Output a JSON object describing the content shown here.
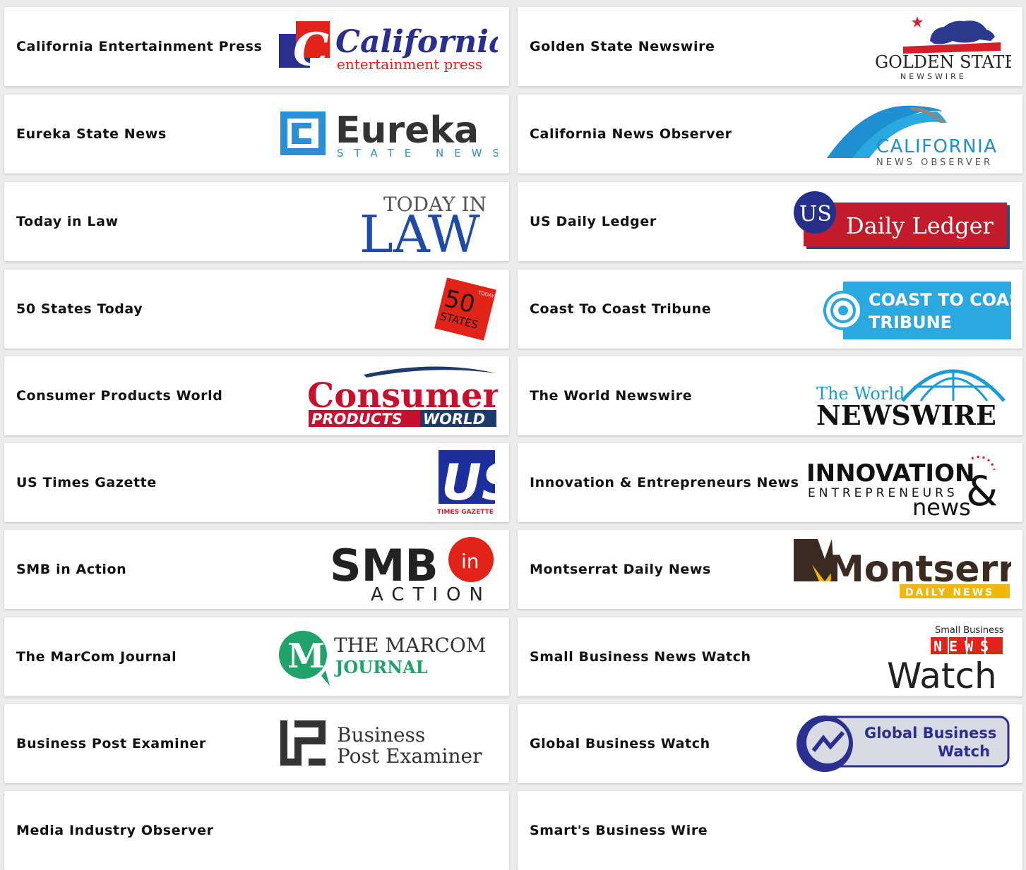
{
  "publications": [
    {
      "name": "California Entertainment Press",
      "logo_icon": "california-entertainment-press-logo",
      "logo_text": [
        "California",
        "entertainment press"
      ],
      "colors": {
        "blue": "#2a2f8f",
        "red": "#e2231a"
      }
    },
    {
      "name": "Golden State Newswire",
      "logo_icon": "golden-state-newswire-logo",
      "logo_text": [
        "GOLDEN STATE",
        "NEWSWIRE"
      ],
      "colors": {
        "blue": "#2b3a8c",
        "red": "#d5202b"
      }
    },
    {
      "name": "Eureka State News",
      "logo_icon": "eureka-state-news-logo",
      "logo_text": [
        "Eureka",
        "STATE NEWS"
      ],
      "colors": {
        "blue": "#2b8fd6",
        "dark": "#333333"
      }
    },
    {
      "name": "California News Observer",
      "logo_icon": "california-news-observer-logo",
      "logo_text": [
        "CALIFORNIA",
        "NEWS OBSERVER"
      ],
      "colors": {
        "blue": "#1e8fd0",
        "gray": "#555555"
      }
    },
    {
      "name": "Today in Law",
      "logo_icon": "today-in-law-logo",
      "logo_text": [
        "TODAY IN",
        "LAW"
      ],
      "colors": {
        "blue": "#1f4aa8",
        "gray": "#555555"
      }
    },
    {
      "name": "US Daily Ledger",
      "logo_icon": "us-daily-ledger-logo",
      "logo_text": [
        "US",
        "Daily Ledger"
      ],
      "colors": {
        "blue": "#262f8a",
        "red": "#c21c2c"
      }
    },
    {
      "name": "50 States Today",
      "logo_icon": "50-states-today-logo",
      "logo_text": [
        "50",
        "STATES",
        "TODAY"
      ],
      "colors": {
        "red": "#e2231a"
      }
    },
    {
      "name": "Coast To Coast Tribune",
      "logo_icon": "coast-to-coast-tribune-logo",
      "logo_text": [
        "COAST TO COAST",
        "TRIBUNE"
      ],
      "colors": {
        "blue": "#2aa8e0"
      }
    },
    {
      "name": "Consumer Products World",
      "logo_icon": "consumer-products-world-logo",
      "logo_text": [
        "Consumer",
        "PRODUCTS",
        "WORLD"
      ],
      "colors": {
        "red": "#c8102e",
        "navy": "#1d3a6e"
      }
    },
    {
      "name": "The World Newswire",
      "logo_icon": "the-world-newswire-logo",
      "logo_text": [
        "The World",
        "NEWSWIRE"
      ],
      "colors": {
        "blue": "#1a9ad6",
        "dark": "#111111"
      }
    },
    {
      "name": "US Times Gazette",
      "logo_icon": "us-times-gazette-logo",
      "logo_text": [
        "US",
        "TIMES GAZETTE"
      ],
      "colors": {
        "blue": "#1c2f9c",
        "red": "#d52027"
      }
    },
    {
      "name": "Innovation & Entrepreneurs News",
      "logo_icon": "innovation-entrepreneurs-news-logo",
      "logo_text": [
        "INNOVATION",
        "ENTREPRENEURS",
        "news",
        "&"
      ],
      "colors": {
        "dark": "#111111",
        "red": "#d52027"
      }
    },
    {
      "name": "SMB in Action",
      "logo_icon": "smb-in-action-logo",
      "logo_text": [
        "SMB",
        "in",
        "ACTION"
      ],
      "colors": {
        "dark": "#222222",
        "red": "#e2231a"
      }
    },
    {
      "name": "Montserrat Daily News",
      "logo_icon": "montserrat-daily-news-logo",
      "logo_text": [
        "Montserrat",
        "DAILY NEWS"
      ],
      "colors": {
        "brown": "#3a2a22",
        "yellow": "#f2b705"
      }
    },
    {
      "name": "The MarCom Journal",
      "logo_icon": "marcom-journal-logo",
      "logo_text": [
        "THE MARCOM",
        "JOURNAL"
      ],
      "colors": {
        "green": "#1fa36a",
        "dark": "#333333"
      }
    },
    {
      "name": "Small Business News Watch",
      "logo_icon": "small-business-news-watch-logo",
      "logo_text": [
        "Small Business",
        "NEWS",
        "Watch"
      ],
      "colors": {
        "red": "#e2231a",
        "dark": "#222222"
      }
    },
    {
      "name": "Business Post Examiner",
      "logo_icon": "business-post-examiner-logo",
      "logo_text": [
        "Business",
        "Post Examiner"
      ],
      "colors": {
        "dark": "#333333"
      }
    },
    {
      "name": "Global Business Watch",
      "logo_icon": "global-business-watch-logo",
      "logo_text": [
        "Global Business",
        "Watch"
      ],
      "colors": {
        "navy": "#2b2f8f",
        "light": "#d9dbe4"
      }
    },
    {
      "name": "Media Industry Observer",
      "logo_icon": "media-industry-observer-logo",
      "logo_text": [],
      "colors": {}
    },
    {
      "name": "Smart's Business Wire",
      "logo_icon": "smarts-business-wire-logo",
      "logo_text": [],
      "colors": {}
    }
  ]
}
